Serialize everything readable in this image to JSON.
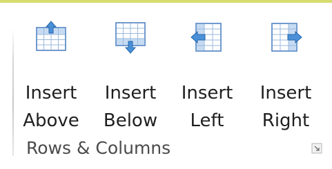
{
  "ribbon": {
    "group_label": "Rows & Columns",
    "accent_color": "#d6dc6e",
    "buttons": [
      {
        "line1": "Insert",
        "line2": "Above",
        "icon": "insert-row-above-icon"
      },
      {
        "line1": "Insert",
        "line2": "Below",
        "icon": "insert-row-below-icon"
      },
      {
        "line1": "Insert",
        "line2": "Left",
        "icon": "insert-column-left-icon"
      },
      {
        "line1": "Insert",
        "line2": "Right",
        "icon": "insert-column-right-icon"
      }
    ],
    "launcher_icon": "dialog-launcher-icon"
  }
}
